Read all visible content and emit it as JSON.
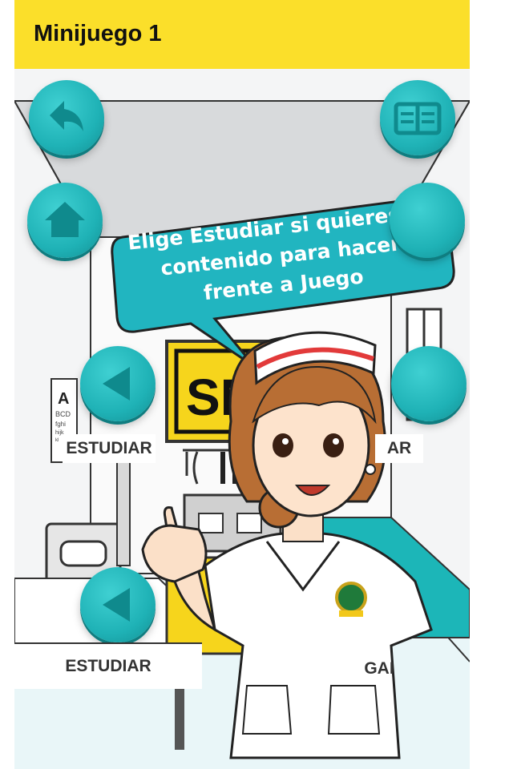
{
  "header": {
    "title": "Minijuego 1"
  },
  "buttons": {
    "back_icon": "undo-arrow-icon",
    "book_icon": "book-icon",
    "home_icon": "home-icon"
  },
  "cards": [
    {
      "label": "ESTUDIAR"
    },
    {
      "label": "AR"
    },
    {
      "label": "ESTUDIAR"
    },
    {
      "label": "GAI"
    }
  ],
  "speech_bubble": {
    "text": "Elige Estudiar si quieres el contenido para hacer frente a Juego"
  },
  "scene": {
    "sign_text": "SN",
    "eye_chart_letter": "A"
  },
  "colors": {
    "header": "#fbdf2a",
    "accent": "#1fb2b6",
    "bubble": "#21b5c0"
  }
}
